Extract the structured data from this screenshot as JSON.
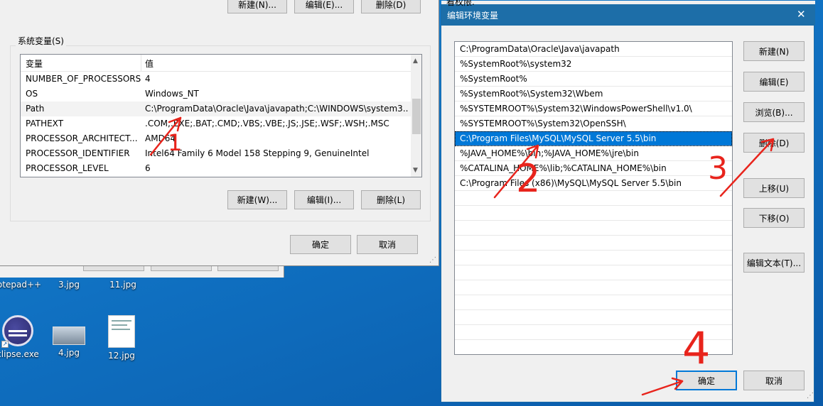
{
  "left_window": {
    "top_buttons": [
      "新建(N)...",
      "编辑(E)...",
      "删除(D)"
    ],
    "group_label": "系统变量(S)",
    "columns": [
      "变量",
      "值"
    ],
    "rows": [
      {
        "name": "NUMBER_OF_PROCESSORS",
        "value": "4"
      },
      {
        "name": "OS",
        "value": "Windows_NT"
      },
      {
        "name": "Path",
        "value": "C:\\ProgramData\\Oracle\\Java\\javapath;C:\\WINDOWS\\system3..."
      },
      {
        "name": "PATHEXT",
        "value": ".COM;.EXE;.BAT;.CMD;.VBS;.VBE;.JS;.JSE;.WSF;.WSH;.MSC"
      },
      {
        "name": "PROCESSOR_ARCHITECT...",
        "value": "AMD64"
      },
      {
        "name": "PROCESSOR_IDENTIFIER",
        "value": "Intel64 Family 6 Model 158 Stepping 9, GenuineIntel"
      },
      {
        "name": "PROCESSOR_LEVEL",
        "value": "6"
      }
    ],
    "sys_buttons": [
      "新建(W)...",
      "编辑(I)...",
      "删除(L)"
    ],
    "ok_label": "确定",
    "cancel_label": "取消",
    "top_right_text": "看权限."
  },
  "desktop": {
    "icons": [
      {
        "label": "otepad++"
      },
      {
        "label": "3.jpg"
      },
      {
        "label": "11.jpg"
      },
      {
        "label": "clipse.exe"
      },
      {
        "label": "4.jpg"
      },
      {
        "label": "12.jpg"
      }
    ]
  },
  "edit_dialog": {
    "title": "编辑环境变量",
    "close_glyph": "✕",
    "paths": [
      "C:\\ProgramData\\Oracle\\Java\\javapath",
      "%SystemRoot%\\system32",
      "%SystemRoot%",
      "%SystemRoot%\\System32\\Wbem",
      "%SYSTEMROOT%\\System32\\WindowsPowerShell\\v1.0\\",
      "%SYSTEMROOT%\\System32\\OpenSSH\\",
      "C:\\Program Files\\MySQL\\MySQL Server 5.5\\bin",
      "%JAVA_HOME%\\bin;%JAVA_HOME%\\jre\\bin",
      "%CATALINA_HOME%\\lib;%CATALINA_HOME%\\bin",
      "C:\\Program Files (x86)\\MySQL\\MySQL Server 5.5\\bin"
    ],
    "selected_index": 6,
    "buttons": {
      "new": "新建(N)",
      "edit": "编辑(E)",
      "browse": "浏览(B)...",
      "delete": "删除(D)",
      "move_up": "上移(U)",
      "move_down": "下移(O)",
      "edit_text": "编辑文本(T)...",
      "ok": "确定",
      "cancel": "取消"
    }
  },
  "annotations": {
    "marks": [
      "1",
      "2",
      "3",
      "4"
    ],
    "color": "#e8241c"
  }
}
